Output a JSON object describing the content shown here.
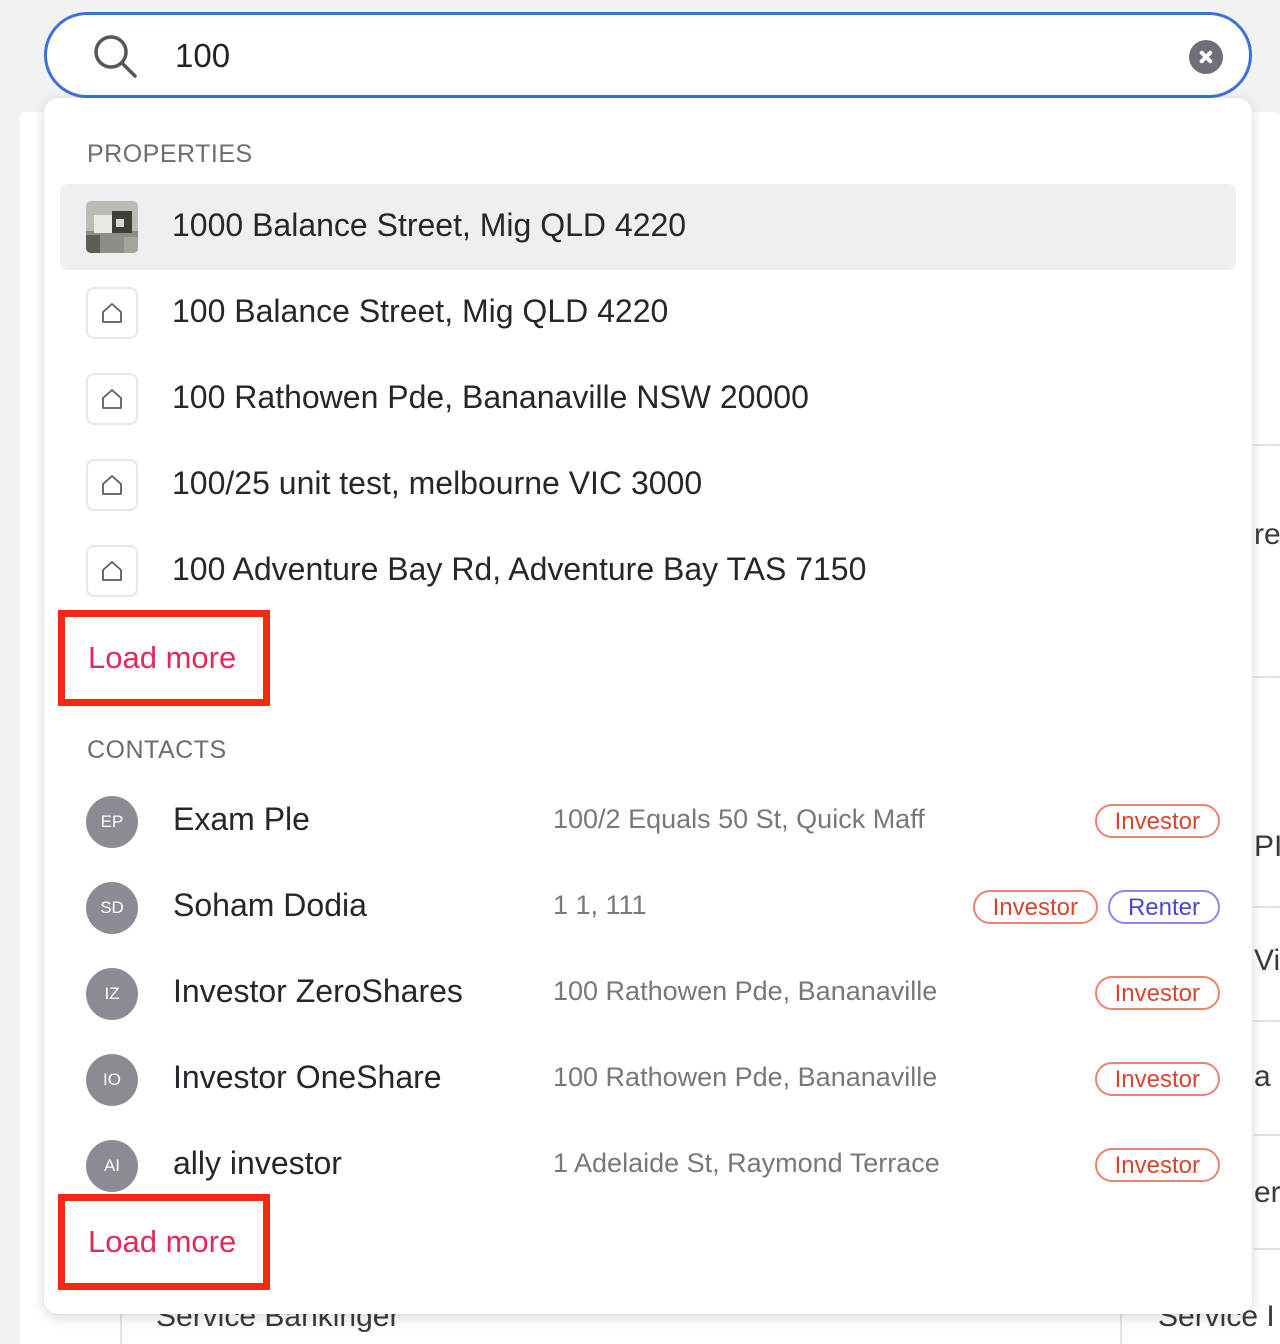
{
  "search": {
    "value": "100",
    "icon": "search-icon",
    "clear_icon": "clear-icon"
  },
  "sections": {
    "properties": {
      "label": "PROPERTIES",
      "items": [
        {
          "address": "1000 Balance Street, Mig QLD 4220",
          "icon": "property-photo"
        },
        {
          "address": "100 Balance Street, Mig QLD 4220",
          "icon": "house-icon"
        },
        {
          "address": "100 Rathowen Pde, Bananaville NSW 20000",
          "icon": "house-icon"
        },
        {
          "address": "100/25 unit test, melbourne VIC 3000",
          "icon": "house-icon"
        },
        {
          "address": "100 Adventure Bay Rd, Adventure Bay TAS 7150",
          "icon": "house-icon"
        }
      ],
      "load_more": "Load more"
    },
    "contacts": {
      "label": "CONTACTS",
      "items": [
        {
          "initials": "EP",
          "name": "Exam Ple",
          "address": "100/2 Equals 50 St, Quick Maff",
          "badges": [
            "Investor"
          ]
        },
        {
          "initials": "SD",
          "name": "Soham Dodia",
          "address": "1 1, 111",
          "badges": [
            "Investor",
            "Renter"
          ]
        },
        {
          "initials": "IZ",
          "name": "Investor ZeroShares",
          "address": "100 Rathowen Pde, Bananaville",
          "badges": [
            "Investor"
          ]
        },
        {
          "initials": "IO",
          "name": "Investor OneShare",
          "address": "100 Rathowen Pde, Bananaville",
          "badges": [
            "Investor"
          ]
        },
        {
          "initials": "AI",
          "name": "ally investor",
          "address": "1 Adelaide St, Raymond Terrace",
          "badges": [
            "Investor"
          ]
        }
      ],
      "load_more": "Load more"
    }
  },
  "background": {
    "fragments": [
      "re",
      "PI",
      "Vil",
      "a D",
      "er"
    ],
    "bottom_left": "Service Bankinger",
    "bottom_right": "Service I"
  },
  "colors": {
    "accent_focus": "#3b72d9",
    "load_more_text": "#e5285a",
    "highlight_border": "#f22a12",
    "investor_badge": "#d8452e",
    "renter_badge": "#4c44d9"
  }
}
